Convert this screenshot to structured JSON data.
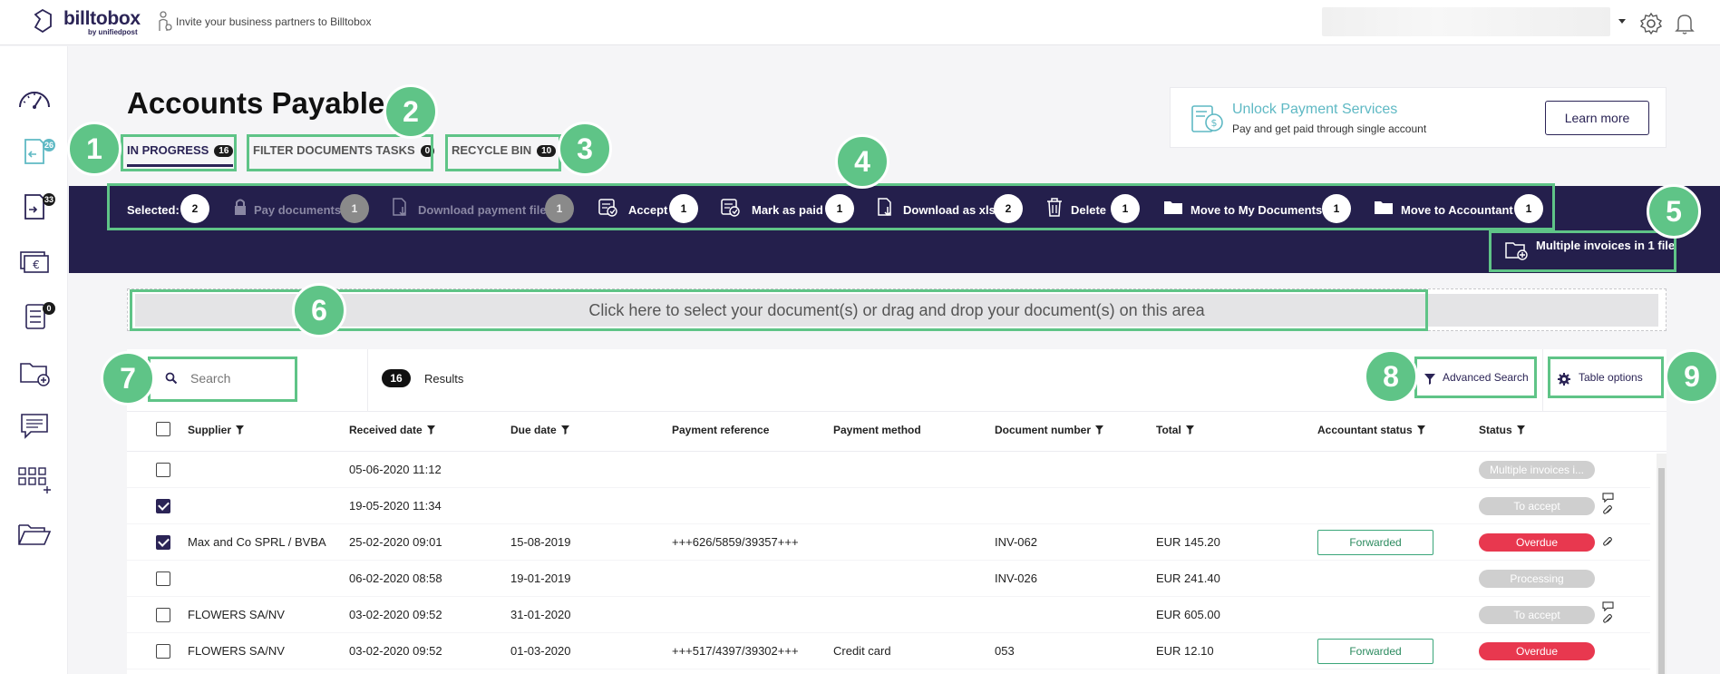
{
  "header": {
    "logo_text": "billtobox",
    "logo_sub": "by unifiedpost",
    "invite_text": "Invite your business partners to Billtobox"
  },
  "sidebar": {
    "badges": {
      "inbox": "26",
      "outbox": "33",
      "tasks": "0"
    }
  },
  "page": {
    "title": "Accounts Payable",
    "tabs": [
      {
        "label": "IN PROGRESS",
        "count": "16",
        "active": true
      },
      {
        "label": "FILTER DOCUMENTS TASKS",
        "count": "0"
      },
      {
        "label": "RECYCLE BIN",
        "count": "10"
      }
    ]
  },
  "promo": {
    "title": "Unlock Payment Services",
    "subtitle": "Pay and get paid through single account",
    "button": "Learn more"
  },
  "actions": {
    "selected_label": "Selected:",
    "selected_count": "2",
    "items": [
      {
        "label": "Pay documents",
        "count": "1",
        "disabled": true,
        "icon": "lock-icon"
      },
      {
        "label": "Download payment file",
        "count": "1",
        "disabled": true,
        "icon": "download-file-icon"
      },
      {
        "label": "Accept",
        "count": "1",
        "icon": "accept-icon"
      },
      {
        "label": "Mark as paid",
        "count": "1",
        "icon": "mark-paid-icon"
      },
      {
        "label": "Download as xls",
        "count": "2",
        "icon": "download-xls-icon"
      },
      {
        "label": "Delete",
        "count": "1",
        "icon": "trash-icon"
      },
      {
        "label": "Move to My Documents",
        "count": "1",
        "icon": "folder-icon"
      },
      {
        "label": "Move to Accountant",
        "count": "1",
        "icon": "folder-icon"
      }
    ],
    "multiple_invoices": "Multiple invoices in 1 file"
  },
  "dropzone": {
    "text": "Click here to select your document(s) or drag and drop your document(s) on this area"
  },
  "toolbar": {
    "search_placeholder": "Search",
    "results_count": "16",
    "results_label": "Results",
    "advanced_search": "Advanced Search",
    "table_options": "Table options"
  },
  "table": {
    "columns": [
      "Supplier",
      "Received date",
      "Due date",
      "Payment reference",
      "Payment method",
      "Document number",
      "Total",
      "Accountant status",
      "Status"
    ],
    "rows": [
      {
        "checked": false,
        "supplier": "",
        "received": "05-06-2020 11:12",
        "due": "",
        "reference": "",
        "method": "",
        "docnum": "",
        "total": "",
        "accountant": "",
        "status": "Multiple invoices i...",
        "status_color": "#cfcfcf",
        "comment": false,
        "attach": false
      },
      {
        "checked": true,
        "supplier": "",
        "received": "19-05-2020 11:34",
        "due": "",
        "reference": "",
        "method": "",
        "docnum": "",
        "total": "",
        "accountant": "",
        "status": "To accept",
        "status_color": "#cfcfcf",
        "comment": true,
        "attach": true
      },
      {
        "checked": true,
        "supplier": "Max and Co SPRL / BVBA",
        "received": "25-02-2020 09:01",
        "due": "15-08-2019",
        "reference": "+++626/5859/39357+++",
        "method": "",
        "docnum": "INV-062",
        "total": "EUR 145.20",
        "accountant": "Forwarded",
        "status": "Overdue",
        "status_color": "#e8384f",
        "comment": false,
        "attach": true
      },
      {
        "checked": false,
        "supplier": "",
        "received": "06-02-2020 08:58",
        "due": "19-01-2019",
        "reference": "",
        "method": "",
        "docnum": "INV-026",
        "total": "EUR 241.40",
        "accountant": "",
        "status": "Processing",
        "status_color": "#cfcfcf",
        "comment": false,
        "attach": false
      },
      {
        "checked": false,
        "supplier": "FLOWERS SA/NV",
        "received": "03-02-2020 09:52",
        "due": "31-01-2020",
        "reference": "",
        "method": "",
        "docnum": "",
        "total": "EUR 605.00",
        "accountant": "",
        "status": "To accept",
        "status_color": "#cfcfcf",
        "comment": true,
        "attach": true
      },
      {
        "checked": false,
        "supplier": "FLOWERS SA/NV",
        "received": "03-02-2020 09:52",
        "due": "01-03-2020",
        "reference": "+++517/4397/39302+++",
        "method": "Credit card",
        "docnum": "053",
        "total": "EUR 12.10",
        "accountant": "Forwarded",
        "status": "Overdue",
        "status_color": "#e8384f",
        "comment": false,
        "attach": false
      }
    ]
  },
  "annotations": [
    "1",
    "2",
    "3",
    "4",
    "5",
    "6",
    "7",
    "8",
    "9"
  ],
  "colors": {
    "brand": "#2b2456",
    "accent": "#5fc487",
    "overdue": "#e8384f",
    "neutral_status": "#cfcfcf"
  }
}
